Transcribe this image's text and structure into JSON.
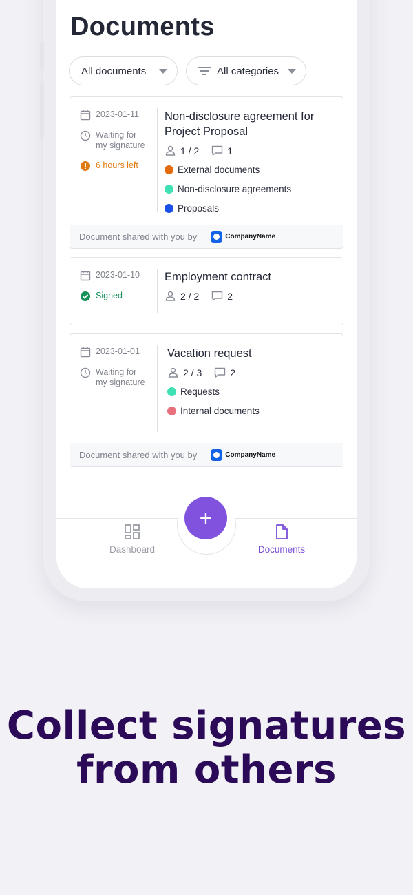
{
  "page_title": "Documents",
  "filters": {
    "documents": "All documents",
    "categories": "All categories"
  },
  "documents": [
    {
      "date": "2023-01-11",
      "status": "Waiting for my signature",
      "status_line1": "Waiting for",
      "status_line2": "my signature",
      "deadline": "6 hours left",
      "title": "Non-disclosure agreement for Project Proposal",
      "signers": "1 / 2",
      "comments": "1",
      "tags": [
        {
          "label": "External documents",
          "color": "#e36b0c"
        },
        {
          "label": "Non-disclosure agreements",
          "color": "#3fe0b4"
        },
        {
          "label": "Proposals",
          "color": "#1a4fe8"
        }
      ],
      "shared_by_text": "Document shared with you by",
      "company": "CompanyName"
    },
    {
      "date": "2023-01-10",
      "status": "Signed",
      "title": "Employment contract",
      "signers": "2 / 2",
      "comments": "2"
    },
    {
      "date": "2023-01-01",
      "status_line1": "Waiting for",
      "status_line2": "my signature",
      "title": "Vacation request",
      "signers": "2 / 3",
      "comments": "2",
      "tags": [
        {
          "label": "Requests",
          "color": "#3fe0b4"
        },
        {
          "label": "Internal documents",
          "color": "#e8707c"
        }
      ],
      "shared_by_text": "Document shared with you by",
      "company": "CompanyName"
    }
  ],
  "nav": {
    "dashboard": "Dashboard",
    "documents": "Documents",
    "fab": "+"
  },
  "headline": {
    "line1": "Collect signatures",
    "line2": "from others"
  },
  "colors": {
    "accent": "#8152dd",
    "headline": "#2b0a57",
    "warning": "#e07a10",
    "success": "#17915a"
  }
}
